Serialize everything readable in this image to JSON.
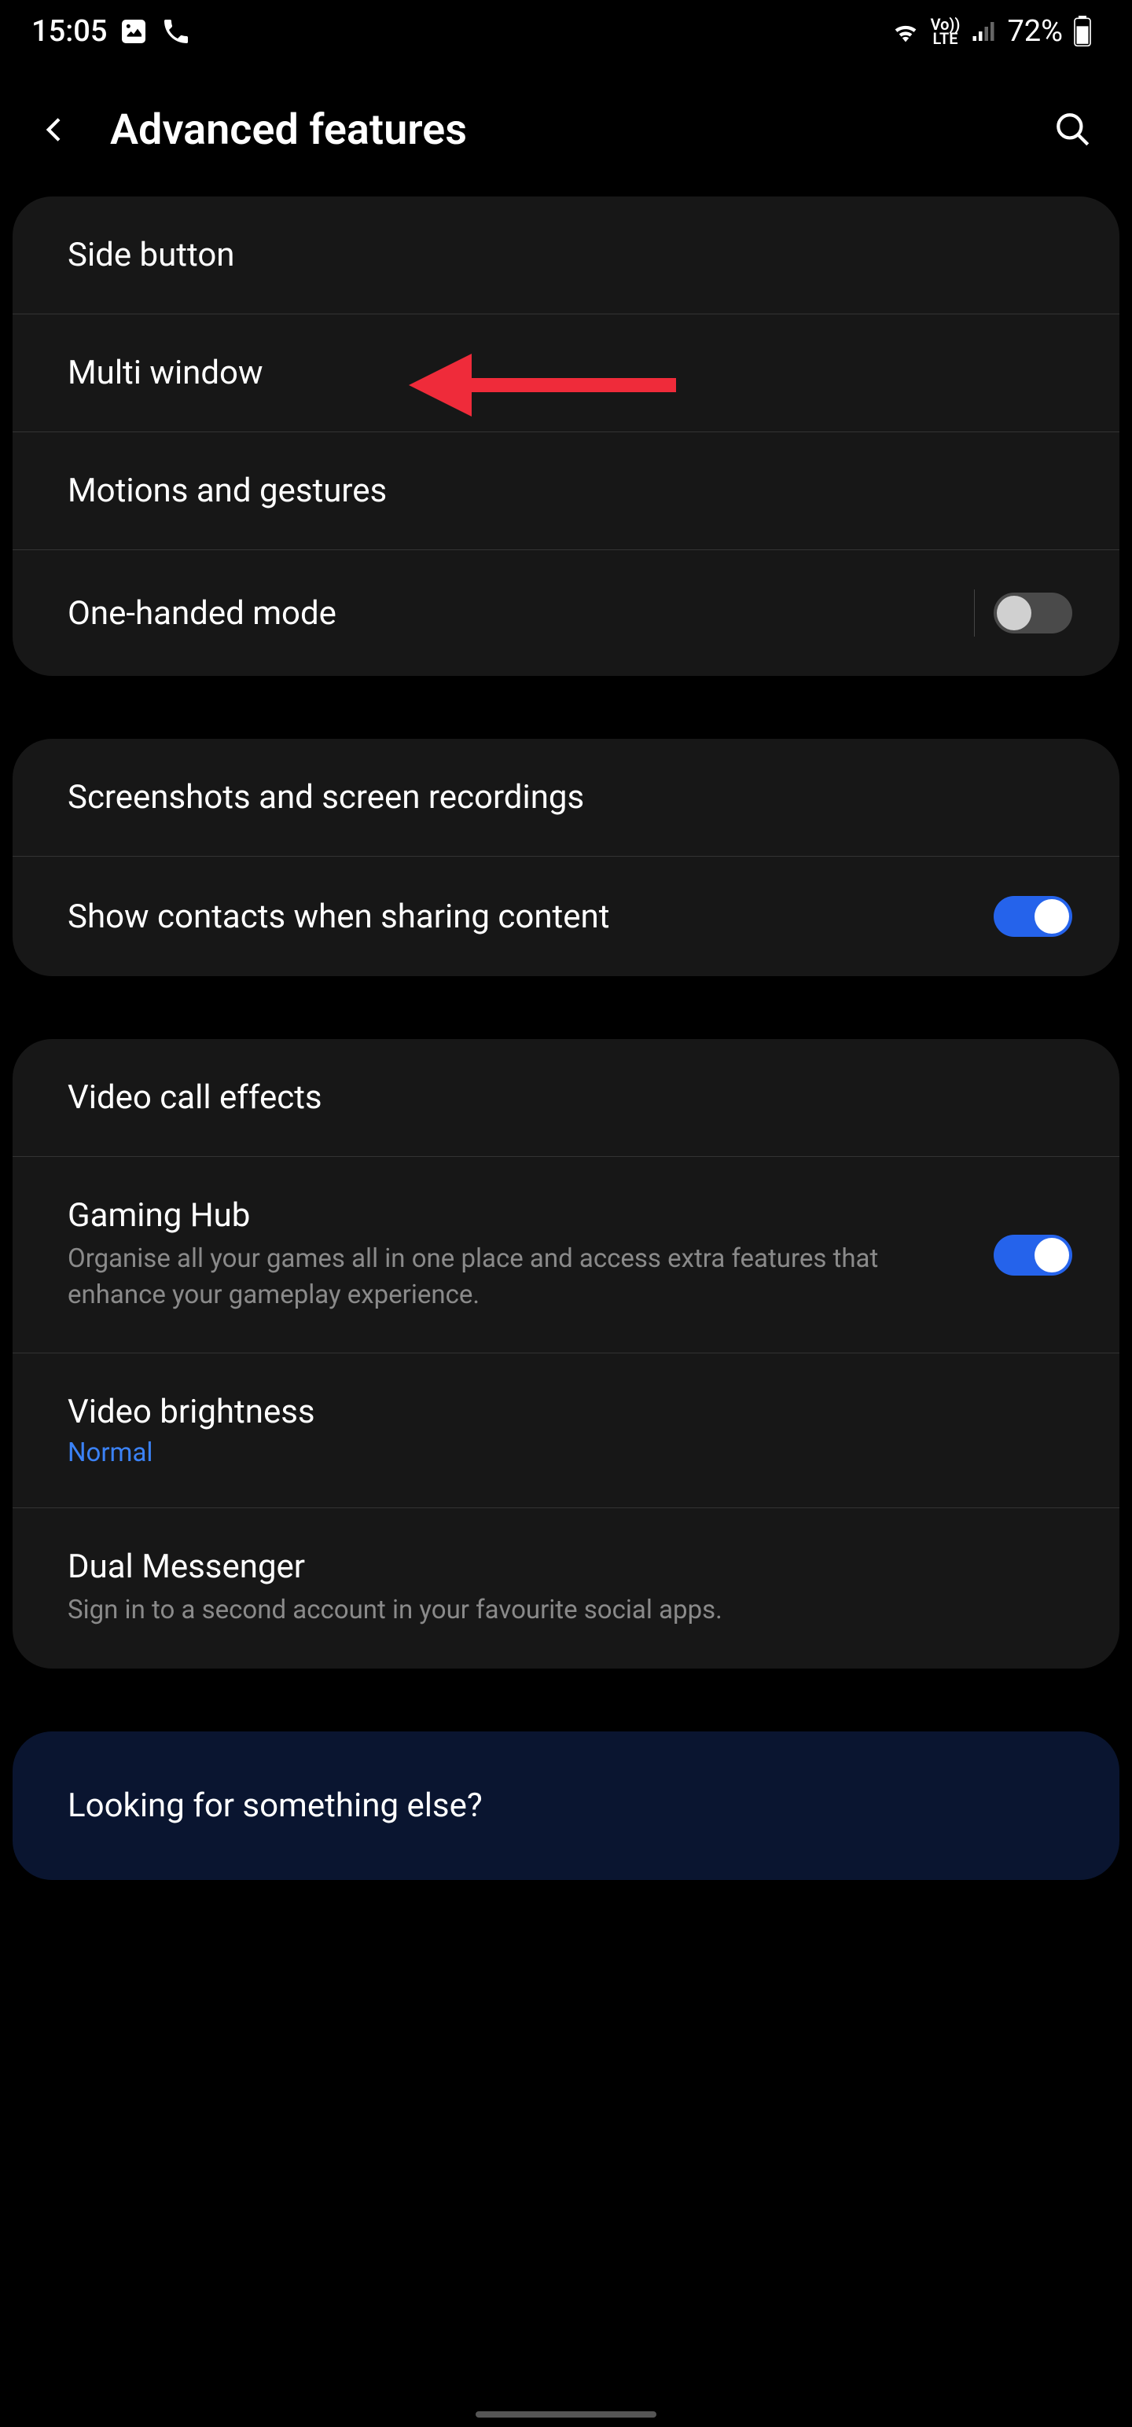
{
  "statusbar": {
    "time": "15:05",
    "battery_pct": "72%"
  },
  "header": {
    "title": "Advanced features"
  },
  "cards": [
    {
      "items": [
        {
          "title": "Side button"
        },
        {
          "title": "Multi window"
        },
        {
          "title": "Motions and gestures"
        },
        {
          "title": "One-handed mode",
          "toggle": "off",
          "divider": true
        }
      ]
    },
    {
      "items": [
        {
          "title": "Screenshots and screen recordings"
        },
        {
          "title": "Show contacts when sharing content",
          "toggle": "on"
        }
      ]
    },
    {
      "items": [
        {
          "title": "Video call effects"
        },
        {
          "title": "Gaming Hub",
          "subtitle": "Organise all your games all in one place and access extra features that enhance your gameplay experience.",
          "toggle": "on"
        },
        {
          "title": "Video brightness",
          "value": "Normal"
        },
        {
          "title": "Dual Messenger",
          "subtitle": "Sign in to a second account in your favourite social apps."
        }
      ]
    }
  ],
  "footer": {
    "title": "Looking for something else?"
  }
}
